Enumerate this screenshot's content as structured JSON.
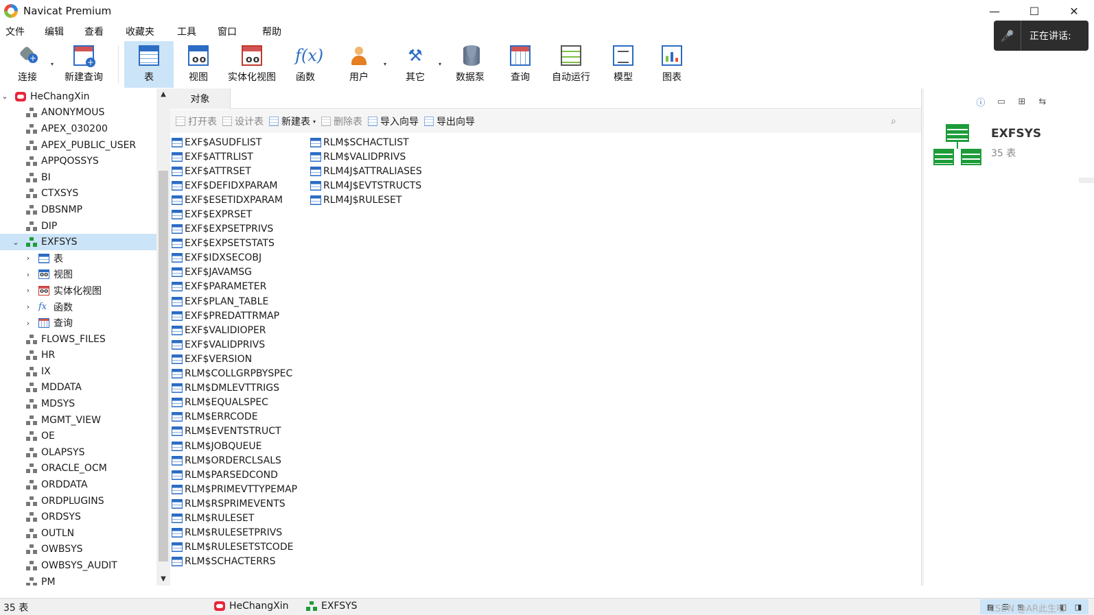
{
  "window": {
    "title": "Navicat Premium",
    "minimize": "—",
    "maximize": "☐",
    "close": "✕"
  },
  "menu": [
    "文件",
    "编辑",
    "查看",
    "收藏夹",
    "工具",
    "窗口",
    "帮助"
  ],
  "speaking": {
    "label": "正在讲话:"
  },
  "toolbar": [
    {
      "id": "connect",
      "label": "连接",
      "icon": "connection-plug-icon",
      "dropdown": true
    },
    {
      "id": "new-query",
      "label": "新建查询",
      "icon": "new-query-icon"
    },
    {
      "id": "table",
      "label": "表",
      "icon": "table-icon",
      "active": true
    },
    {
      "id": "view",
      "label": "视图",
      "icon": "view-icon"
    },
    {
      "id": "matview",
      "label": "实体化视图",
      "icon": "materialized-view-icon"
    },
    {
      "id": "function",
      "label": "函数",
      "icon": "function-icon"
    },
    {
      "id": "user",
      "label": "用户",
      "icon": "user-icon",
      "dropdown": true
    },
    {
      "id": "other",
      "label": "其它",
      "icon": "tools-icon",
      "dropdown": true
    },
    {
      "id": "datapump",
      "label": "数据泵",
      "icon": "data-pump-icon"
    },
    {
      "id": "query",
      "label": "查询",
      "icon": "query-icon"
    },
    {
      "id": "automation",
      "label": "自动运行",
      "icon": "automation-icon"
    },
    {
      "id": "model",
      "label": "模型",
      "icon": "model-icon"
    },
    {
      "id": "chart",
      "label": "图表",
      "icon": "chart-icon"
    }
  ],
  "tree": {
    "connection": "HeChangXin",
    "schemas_before": [
      "ANONYMOUS",
      "APEX_030200",
      "APEX_PUBLIC_USER",
      "APPQOSSYS",
      "BI",
      "CTXSYS",
      "DBSNMP",
      "DIP"
    ],
    "selected_schema": "EXFSYS",
    "children": [
      {
        "label": "表",
        "icon": "table-icon"
      },
      {
        "label": "视图",
        "icon": "view-icon"
      },
      {
        "label": "实体化视图",
        "icon": "materialized-view-icon"
      },
      {
        "label": "函数",
        "icon": "function-icon"
      },
      {
        "label": "查询",
        "icon": "query-icon"
      }
    ],
    "schemas_after": [
      "FLOWS_FILES",
      "HR",
      "IX",
      "MDDATA",
      "MDSYS",
      "MGMT_VIEW",
      "OE",
      "OLAPSYS",
      "ORACLE_OCM",
      "ORDDATA",
      "ORDPLUGINS",
      "ORDSYS",
      "OUTLN",
      "OWBSYS",
      "OWBSYS_AUDIT",
      "PM"
    ]
  },
  "objects_tab": {
    "label": "对象"
  },
  "object_toolbar": [
    {
      "label": "打开表",
      "disabled": true
    },
    {
      "label": "设计表",
      "disabled": true
    },
    {
      "label": "新建表",
      "disabled": false,
      "dropdown": true
    },
    {
      "label": "删除表",
      "disabled": true
    },
    {
      "label": "导入向导",
      "disabled": false
    },
    {
      "label": "导出向导",
      "disabled": false
    }
  ],
  "objects": {
    "column1": [
      "EXF$ASUDFLIST",
      "EXF$ATTRLIST",
      "EXF$ATTRSET",
      "EXF$DEFIDXPARAM",
      "EXF$ESETIDXPARAM",
      "EXF$EXPRSET",
      "EXF$EXPSETPRIVS",
      "EXF$EXPSETSTATS",
      "EXF$IDXSECOBJ",
      "EXF$JAVAMSG",
      "EXF$PARAMETER",
      "EXF$PLAN_TABLE",
      "EXF$PREDATTRMAP",
      "EXF$VALIDIOPER",
      "EXF$VALIDPRIVS",
      "EXF$VERSION",
      "RLM$COLLGRPBYSPEC",
      "RLM$DMLEVTTRIGS",
      "RLM$EQUALSPEC",
      "RLM$ERRCODE",
      "RLM$EVENTSTRUCT",
      "RLM$JOBQUEUE",
      "RLM$ORDERCLSALS",
      "RLM$PARSEDCOND",
      "RLM$PRIMEVTTYPEMAP",
      "RLM$RSPRIMEVENTS",
      "RLM$RULESET",
      "RLM$RULESETPRIVS",
      "RLM$RULESETSTCODE",
      "RLM$SCHACTERRS"
    ],
    "column2": [
      "RLM$SCHACTLIST",
      "RLM$VALIDPRIVS",
      "RLM4J$ATTRALIASES",
      "RLM4J$EVTSTRUCTS",
      "RLM4J$RULESET"
    ]
  },
  "info_panel": {
    "name": "EXFSYS",
    "count": "35 表"
  },
  "status": {
    "count": "35 表",
    "connection": "HeChangXin",
    "schema": "EXFSYS",
    "watermark": "CSDN @AR此生哈"
  }
}
